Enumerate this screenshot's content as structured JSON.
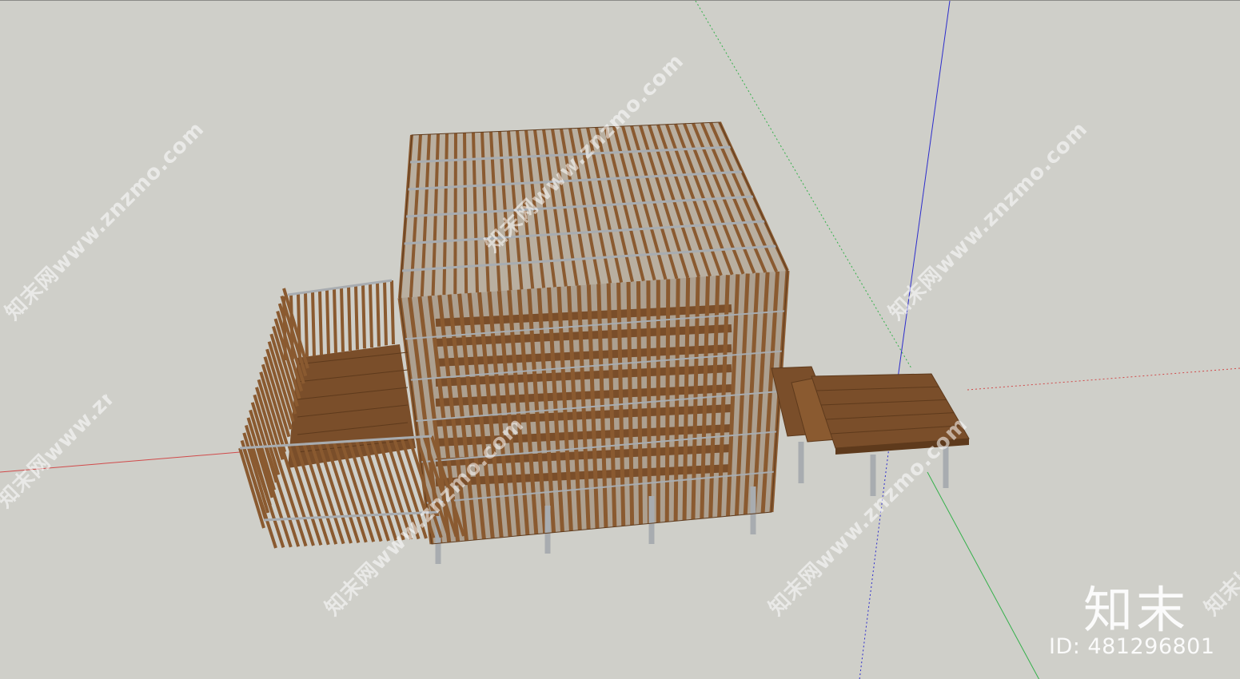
{
  "viewport": {
    "background": "#cfcfc9",
    "axes": {
      "red": "#d04a4a",
      "green": "#34b04a",
      "blue": "#2d2dcc"
    }
  },
  "model": {
    "wood_color": "#8a5a30",
    "wood_dark": "#5e3a1c",
    "deck_color": "#7a4e2a",
    "steel_color": "#a8acb0"
  },
  "watermark": {
    "text": "知末网www.znzmo.com",
    "logo": "知末",
    "id_label": "ID: 481296801"
  }
}
